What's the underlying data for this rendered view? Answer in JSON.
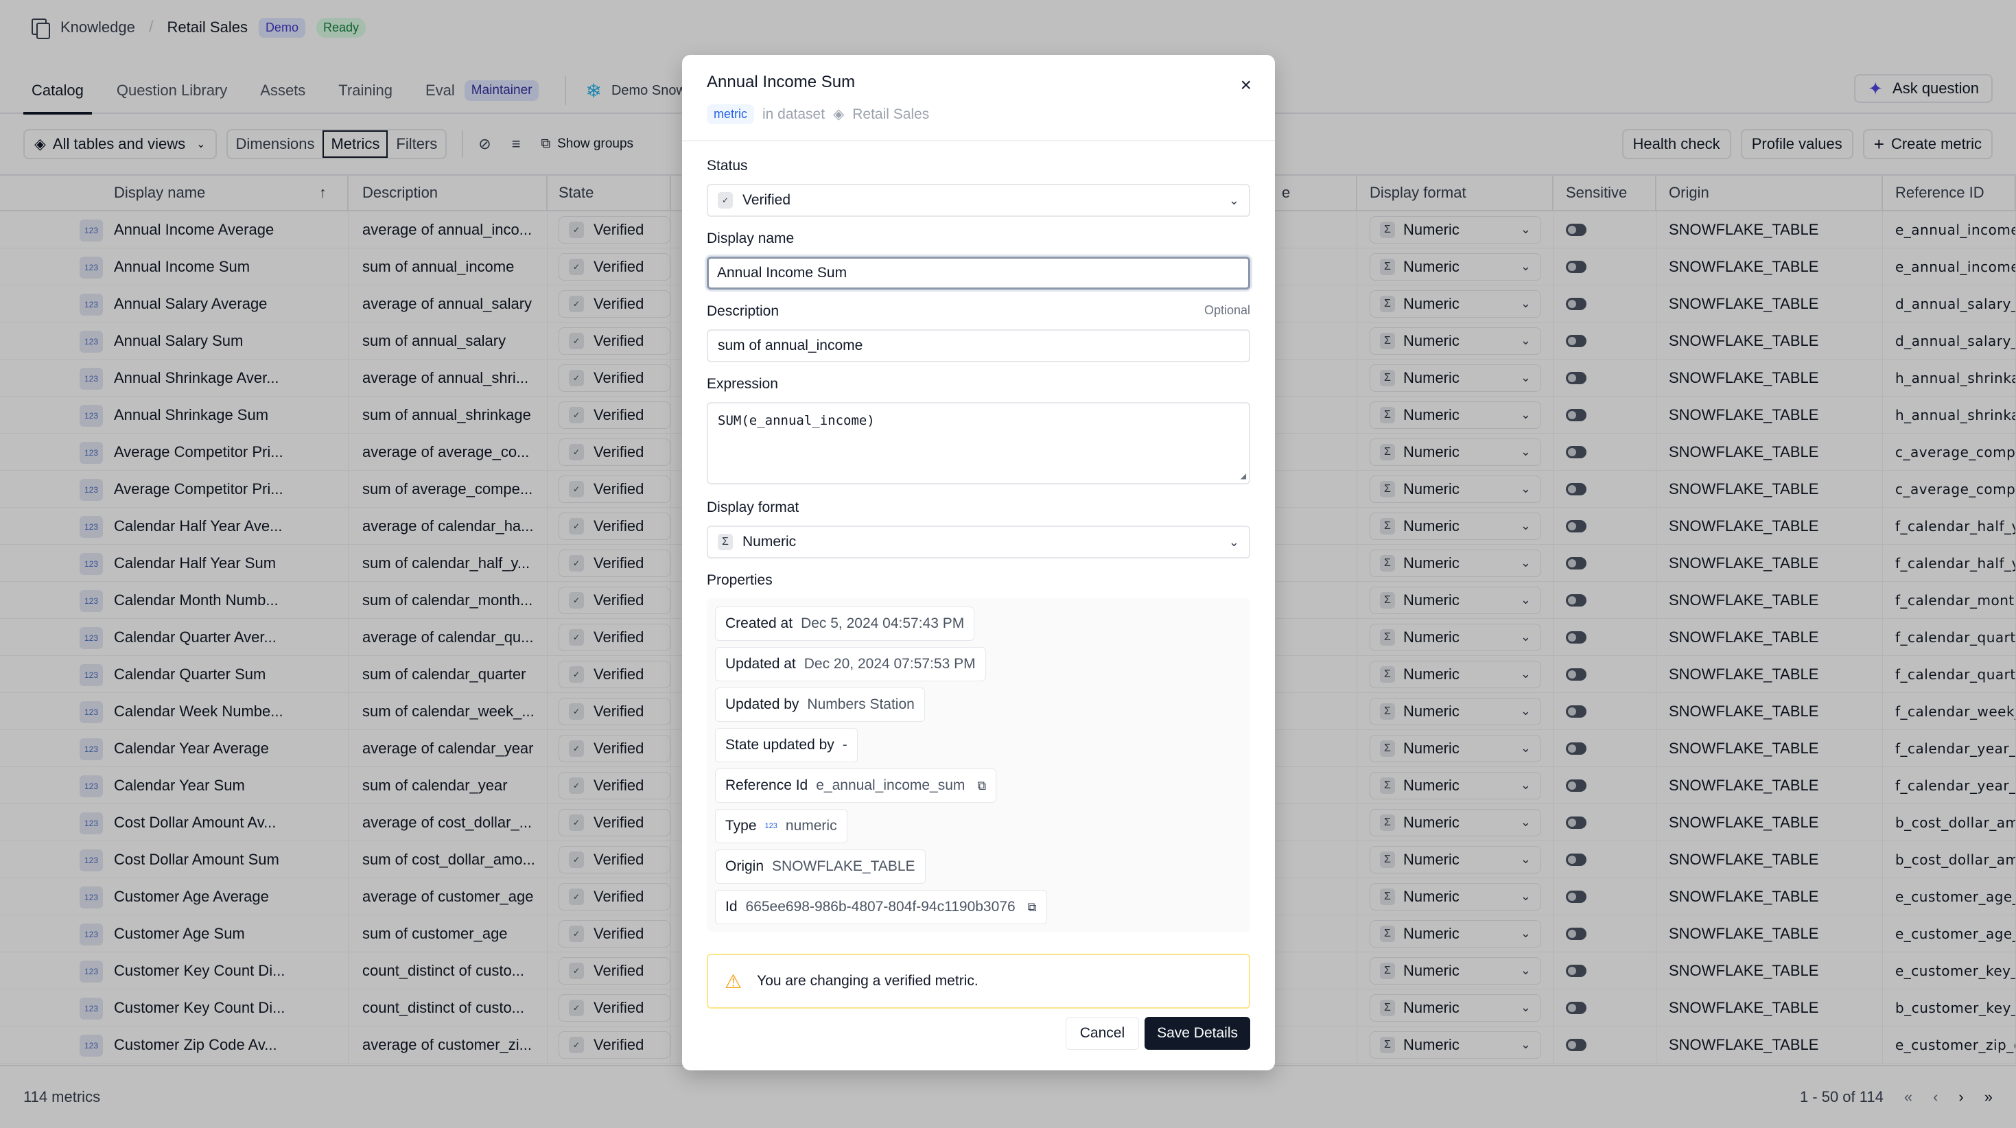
{
  "header": {
    "section": "Knowledge",
    "dataset": "Retail Sales",
    "badge_demo": "Demo",
    "badge_status": "Ready"
  },
  "tabs": [
    {
      "label": "Catalog",
      "active": true
    },
    {
      "label": "Question Library"
    },
    {
      "label": "Assets"
    },
    {
      "label": "Training"
    },
    {
      "label": "Eval",
      "badge": "Maintainer"
    }
  ],
  "connection": {
    "label": "Demo Snowflake",
    "icon": "snowflake-icon"
  },
  "ask_button": {
    "label": "Ask question",
    "icon": "sparkle-icon"
  },
  "toolbar": {
    "scope_label": "All tables and views",
    "segments": [
      "Dimensions",
      "Metrics",
      "Filters"
    ],
    "active_segment": "Metrics",
    "show_groups_label": "Show groups",
    "health_check_label": "Health check",
    "profile_values_label": "Profile values",
    "create_metric_label": "Create metric"
  },
  "table": {
    "columns": {
      "display_name": "Display name",
      "description": "Description",
      "state": "State",
      "hidden_partial": "e",
      "display_format": "Display format",
      "sensitive": "Sensitive",
      "origin": "Origin",
      "reference_id": "Reference ID"
    },
    "sort": {
      "column": "Display name",
      "direction": "ascending"
    },
    "rows": [
      {
        "name": "Annual Income Average",
        "desc": "average of annual_inco...",
        "state": "Verified",
        "format": "Numeric",
        "sensitive": false,
        "origin": "SNOWFLAKE_TABLE",
        "ref": "e_annual_income_"
      },
      {
        "name": "Annual Income Sum",
        "desc": "sum of annual_income",
        "state": "Verified",
        "format": "Numeric",
        "sensitive": false,
        "origin": "SNOWFLAKE_TABLE",
        "ref": "e_annual_income_"
      },
      {
        "name": "Annual Salary Average",
        "desc": "average of annual_salary",
        "state": "Verified",
        "format": "Numeric",
        "sensitive": false,
        "origin": "SNOWFLAKE_TABLE",
        "ref": "d_annual_salary_a"
      },
      {
        "name": "Annual Salary Sum",
        "desc": "sum of annual_salary",
        "state": "Verified",
        "format": "Numeric",
        "sensitive": false,
        "origin": "SNOWFLAKE_TABLE",
        "ref": "d_annual_salary_s"
      },
      {
        "name": "Annual Shrinkage Aver...",
        "desc": "average of annual_shri...",
        "state": "Verified",
        "format": "Numeric",
        "sensitive": false,
        "origin": "SNOWFLAKE_TABLE",
        "ref": "h_annual_shrinkag"
      },
      {
        "name": "Annual Shrinkage Sum",
        "desc": "sum of annual_shrinkage",
        "state": "Verified",
        "format": "Numeric",
        "sensitive": false,
        "origin": "SNOWFLAKE_TABLE",
        "ref": "h_annual_shrinkag"
      },
      {
        "name": "Average Competitor Pri...",
        "desc": "average of average_co...",
        "state": "Verified",
        "format": "Numeric",
        "sensitive": false,
        "origin": "SNOWFLAKE_TABLE",
        "ref": "c_average_compe"
      },
      {
        "name": "Average Competitor Pri...",
        "desc": "sum of average_compe...",
        "state": "Verified",
        "format": "Numeric",
        "sensitive": false,
        "origin": "SNOWFLAKE_TABLE",
        "ref": "c_average_compe"
      },
      {
        "name": "Calendar Half Year Ave...",
        "desc": "average of calendar_ha...",
        "state": "Verified",
        "format": "Numeric",
        "sensitive": false,
        "origin": "SNOWFLAKE_TABLE",
        "ref": "f_calendar_half_ye"
      },
      {
        "name": "Calendar Half Year Sum",
        "desc": "sum of calendar_half_y...",
        "state": "Verified",
        "format": "Numeric",
        "sensitive": false,
        "origin": "SNOWFLAKE_TABLE",
        "ref": "f_calendar_half_ye"
      },
      {
        "name": "Calendar Month Numb...",
        "desc": "sum of calendar_month...",
        "state": "Verified",
        "format": "Numeric",
        "sensitive": false,
        "origin": "SNOWFLAKE_TABLE",
        "ref": "f_calendar_month"
      },
      {
        "name": "Calendar Quarter Aver...",
        "desc": "average of calendar_qu...",
        "state": "Verified",
        "format": "Numeric",
        "sensitive": false,
        "origin": "SNOWFLAKE_TABLE",
        "ref": "f_calendar_quarte"
      },
      {
        "name": "Calendar Quarter Sum",
        "desc": "sum of calendar_quarter",
        "state": "Verified",
        "format": "Numeric",
        "sensitive": false,
        "origin": "SNOWFLAKE_TABLE",
        "ref": "f_calendar_quarte"
      },
      {
        "name": "Calendar Week Numbe...",
        "desc": "sum of calendar_week_...",
        "state": "Verified",
        "format": "Numeric",
        "sensitive": false,
        "origin": "SNOWFLAKE_TABLE",
        "ref": "f_calendar_week_"
      },
      {
        "name": "Calendar Year Average",
        "desc": "average of calendar_year",
        "state": "Verified",
        "format": "Numeric",
        "sensitive": false,
        "origin": "SNOWFLAKE_TABLE",
        "ref": "f_calendar_year_a"
      },
      {
        "name": "Calendar Year Sum",
        "desc": "sum of calendar_year",
        "state": "Verified",
        "format": "Numeric",
        "sensitive": false,
        "origin": "SNOWFLAKE_TABLE",
        "ref": "f_calendar_year_s"
      },
      {
        "name": "Cost Dollar Amount Av...",
        "desc": "average of cost_dollar_...",
        "state": "Verified",
        "format": "Numeric",
        "sensitive": false,
        "origin": "SNOWFLAKE_TABLE",
        "ref": "b_cost_dollar_amo"
      },
      {
        "name": "Cost Dollar Amount Sum",
        "desc": "sum of cost_dollar_amo...",
        "state": "Verified",
        "format": "Numeric",
        "sensitive": false,
        "origin": "SNOWFLAKE_TABLE",
        "ref": "b_cost_dollar_amo"
      },
      {
        "name": "Customer Age Average",
        "desc": "average of customer_age",
        "state": "Verified",
        "format": "Numeric",
        "sensitive": false,
        "origin": "SNOWFLAKE_TABLE",
        "ref": "e_customer_age_a"
      },
      {
        "name": "Customer Age Sum",
        "desc": "sum of customer_age",
        "state": "Verified",
        "format": "Numeric",
        "sensitive": false,
        "origin": "SNOWFLAKE_TABLE",
        "ref": "e_customer_age_s"
      },
      {
        "name": "Customer Key Count Di...",
        "desc": "count_distinct of custo...",
        "state": "Verified",
        "format": "Numeric",
        "sensitive": false,
        "origin": "SNOWFLAKE_TABLE",
        "ref": "e_customer_key_c"
      },
      {
        "name": "Customer Key Count Di...",
        "desc": "count_distinct of custo...",
        "state": "Verified",
        "format": "Numeric",
        "sensitive": false,
        "origin": "SNOWFLAKE_TABLE",
        "ref": "b_customer_key_c"
      },
      {
        "name": "Customer Zip Code Av...",
        "desc": "average of customer_zi...",
        "state": "Verified",
        "format": "Numeric",
        "sensitive": false,
        "origin": "SNOWFLAKE_TABLE",
        "ref": "e_customer_zip_c"
      }
    ]
  },
  "footer": {
    "count_label": "114 metrics",
    "range_label": "1 - 50 of 114"
  },
  "modal": {
    "title": "Annual Income Sum",
    "kind_badge": "metric",
    "in_dataset_label": "in dataset",
    "dataset": "Retail Sales",
    "status_label": "Status",
    "status_value": "Verified",
    "display_name_label": "Display name",
    "display_name_value": "Annual Income Sum",
    "description_label": "Description",
    "description_optional": "Optional",
    "description_value": "sum of annual_income",
    "expression_label": "Expression",
    "expression_value": "SUM(e_annual_income)",
    "display_format_label": "Display format",
    "display_format_value": "Numeric",
    "properties_label": "Properties",
    "properties": [
      {
        "key": "Created at",
        "value": "Dec 5, 2024 04:57:43 PM"
      },
      {
        "key": "Updated at",
        "value": "Dec 20, 2024 07:57:53 PM"
      },
      {
        "key": "Updated by",
        "value": "Numbers Station"
      },
      {
        "key": "State updated by",
        "value": "-"
      },
      {
        "key": "Reference Id",
        "value": "e_annual_income_sum",
        "copyable": true
      },
      {
        "key": "Type",
        "value": "numeric",
        "type_icon": "123"
      },
      {
        "key": "Origin",
        "value": "SNOWFLAKE_TABLE"
      },
      {
        "key": "Id",
        "value": "665ee698-986b-4807-804f-94c1190b3076",
        "copyable": true
      }
    ],
    "warning": "You are changing a verified metric.",
    "cancel_label": "Cancel",
    "save_label": "Save Details"
  }
}
